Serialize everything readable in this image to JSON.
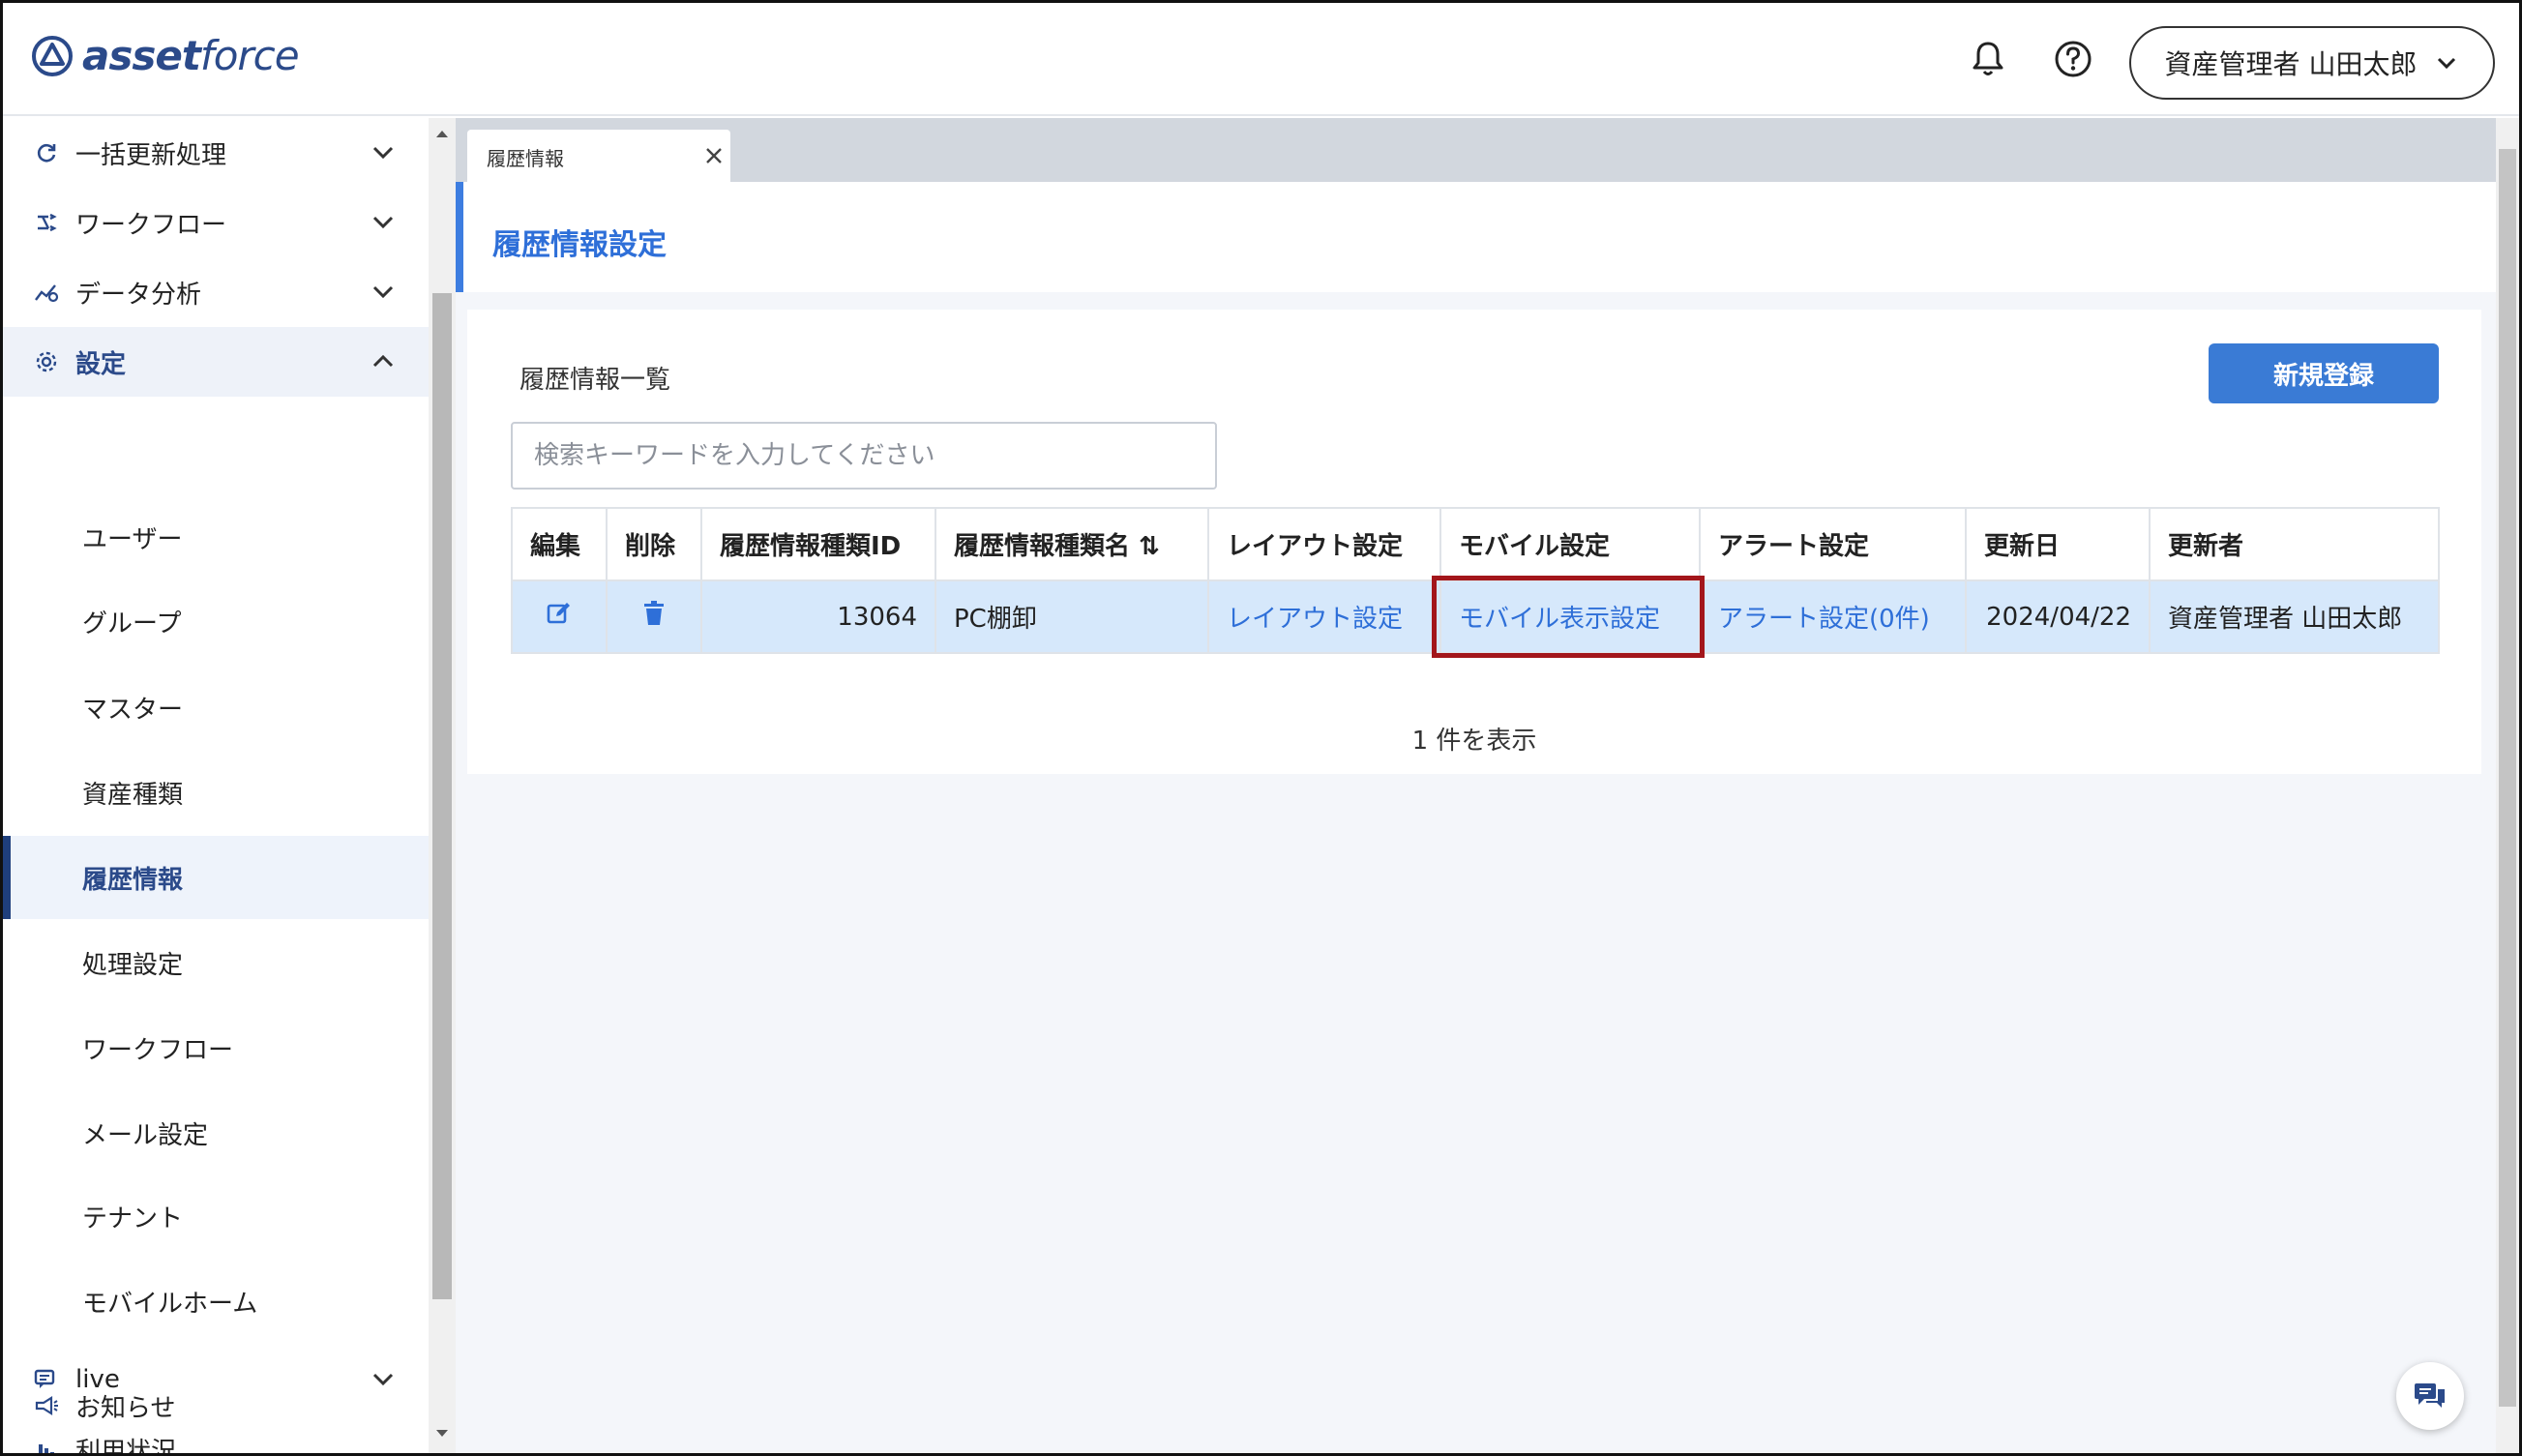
{
  "header": {
    "logo_bold": "asset",
    "logo_light": "force",
    "user_label": "資産管理者 山田太郎"
  },
  "sidebar": {
    "items_top": [
      {
        "label": "一括更新処理",
        "icon": "refresh-icon"
      },
      {
        "label": "ワークフロー",
        "icon": "workflow-icon"
      },
      {
        "label": "データ分析",
        "icon": "analytics-icon"
      },
      {
        "label": "設定",
        "icon": "gear-icon"
      }
    ],
    "settings_sub": [
      {
        "label": "ユーザー"
      },
      {
        "label": "グループ"
      },
      {
        "label": "マスター"
      },
      {
        "label": "資産種類"
      },
      {
        "label": "履歴情報"
      },
      {
        "label": "処理設定"
      },
      {
        "label": "ワークフロー"
      },
      {
        "label": "メール設定"
      },
      {
        "label": "テナント"
      },
      {
        "label": "モバイルホーム"
      }
    ],
    "items_bottom": [
      {
        "label": "live",
        "icon": "live-chat-icon"
      },
      {
        "label": "利用状況",
        "icon": "bar-chart-icon"
      },
      {
        "label": "お知らせ",
        "icon": "megaphone-icon"
      }
    ]
  },
  "tab": {
    "label": "履歴情報"
  },
  "page": {
    "title": "履歴情報設定"
  },
  "card": {
    "title": "履歴情報一覧",
    "new_button": "新規登録",
    "search_placeholder": "検索キーワードを入力してください",
    "columns": [
      "編集",
      "削除",
      "履歴情報種類ID",
      "履歴情報種類名",
      "レイアウト設定",
      "モバイル設定",
      "アラート設定",
      "更新日",
      "更新者"
    ],
    "sort_glyph": "⇅",
    "rows": [
      {
        "id": "13064",
        "name": "PC棚卸",
        "layout": "レイアウト設定",
        "mobile": "モバイル表示設定",
        "alert": "アラート設定(0件)",
        "updated": "2024/04/22",
        "updater": "資産管理者 山田太郎"
      }
    ],
    "count_text": "1 件を表示"
  },
  "colors": {
    "accent": "#3a7bd5",
    "link": "#2e6fd8",
    "highlight_border": "#a3161b",
    "selected_row": "#d6e8fb"
  }
}
